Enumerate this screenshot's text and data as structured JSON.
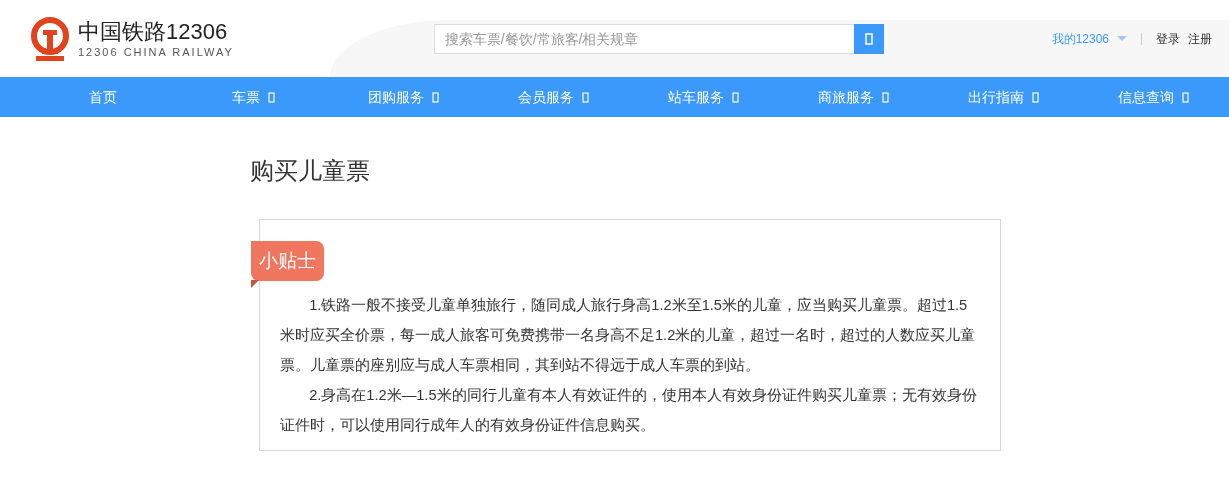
{
  "logo": {
    "title": "中国铁路12306",
    "subtitle": "12306 CHINA RAILWAY"
  },
  "search": {
    "placeholder": "搜索车票/餐饮/常旅客/相关规章"
  },
  "user_links": [
    {
      "label": "我的12306",
      "kind": "menu"
    },
    {
      "label": "登录",
      "kind": "link"
    },
    {
      "label": "注册",
      "kind": "link"
    }
  ],
  "nav": [
    {
      "label": "首页",
      "dropdown": false
    },
    {
      "label": "车票",
      "dropdown": true
    },
    {
      "label": "团购服务",
      "dropdown": true
    },
    {
      "label": "会员服务",
      "dropdown": true
    },
    {
      "label": "站车服务",
      "dropdown": true
    },
    {
      "label": "商旅服务",
      "dropdown": true
    },
    {
      "label": "出行指南",
      "dropdown": true
    },
    {
      "label": "信息查询",
      "dropdown": true
    }
  ],
  "page_title": "购买儿童票",
  "tips": {
    "tag": "小贴士",
    "paragraphs": [
      "1.铁路一般不接受儿童单独旅行，随同成人旅行身高1.2米至1.5米的儿童，应当购买儿童票。超过1.5米时应买全价票，每一成人旅客可免费携带一名身高不足1.2米的儿童，超过一名时，超过的人数应买儿童票。儿童票的座别应与成人车票相同，其到站不得远于成人车票的到站。",
      "2.身高在1.2米—1.5米的同行儿童有本人有效证件的，使用本人有效身份证件购买儿童票；无有效身份证件时，可以使用同行成年人的有效身份证件信息购买。"
    ]
  }
}
